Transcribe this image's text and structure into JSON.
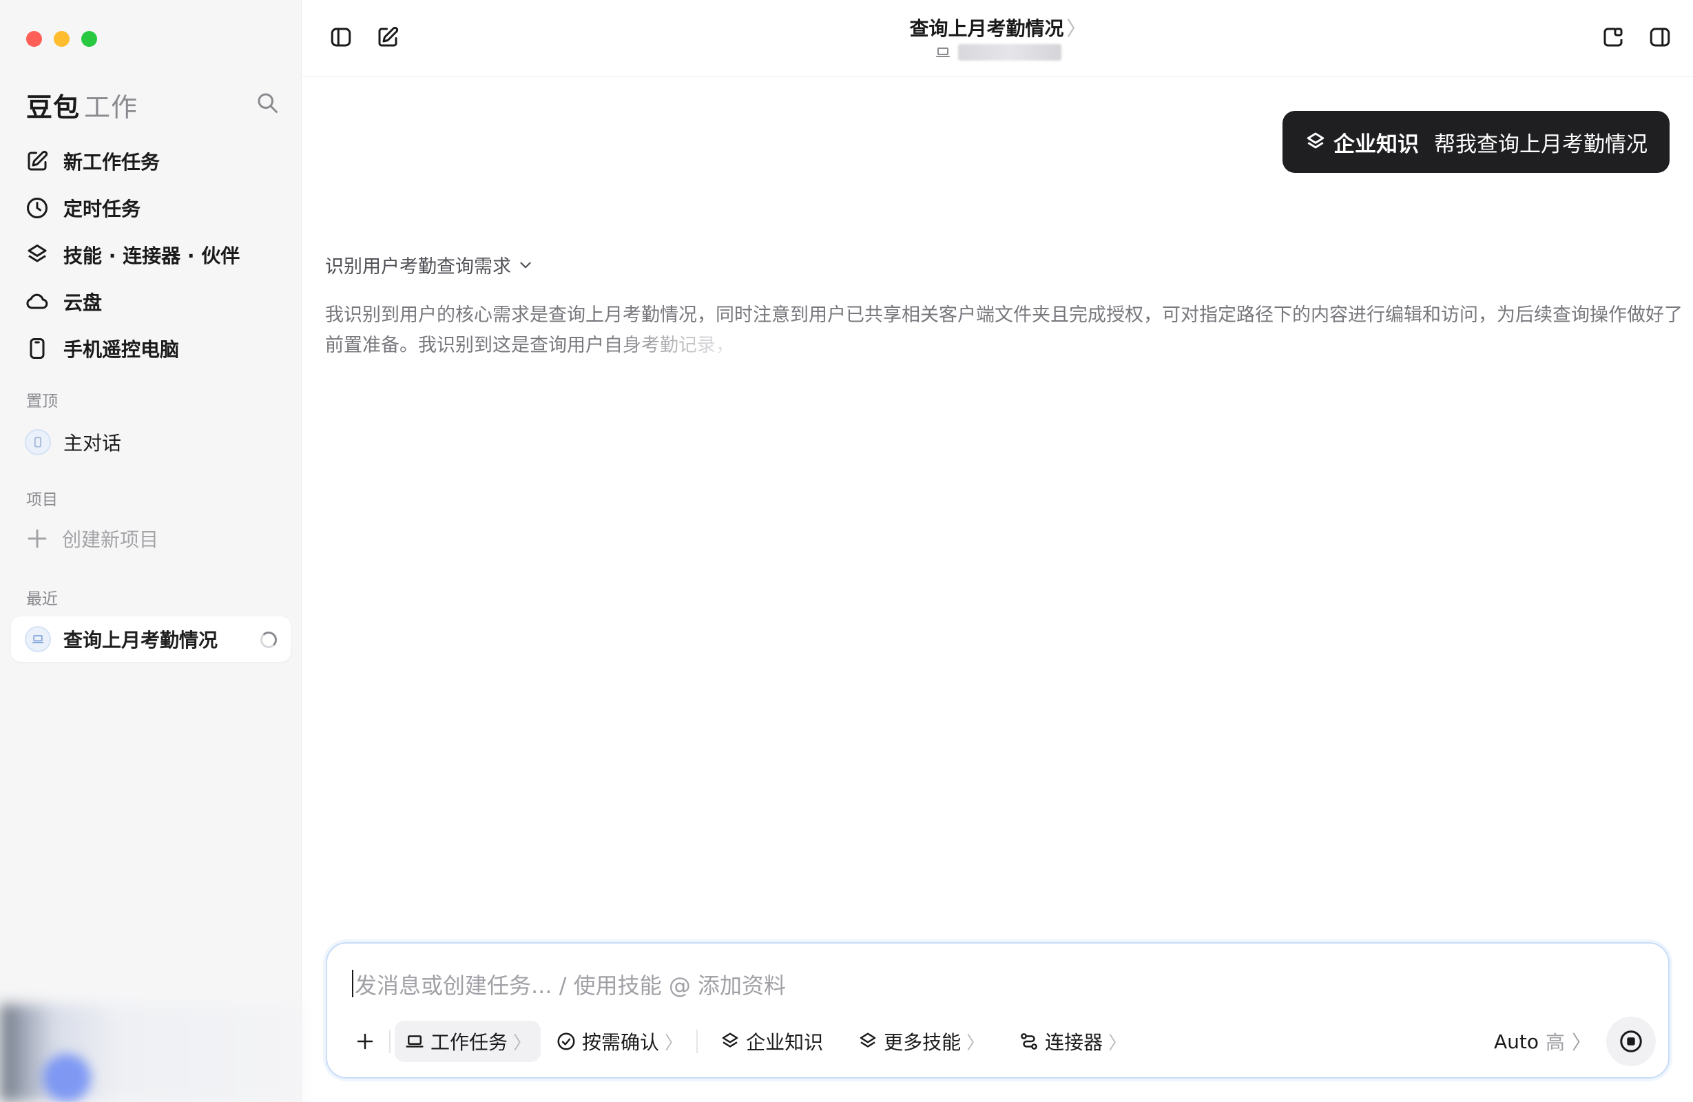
{
  "window": {
    "traffic_colors": [
      "#ff5f57",
      "#febc2e",
      "#28c840"
    ]
  },
  "sidebar": {
    "brand_name": "豆包",
    "brand_sub": "工作",
    "nav": [
      {
        "label": "新工作任务",
        "icon": "edit-icon"
      },
      {
        "label": "定时任务",
        "icon": "clock-icon"
      },
      {
        "label": "技能 · 连接器 · 伙伴",
        "icon": "layers-icon"
      },
      {
        "label": "云盘",
        "icon": "cloud-icon"
      },
      {
        "label": "手机遥控电脑",
        "icon": "phone-icon"
      }
    ],
    "pinned_label": "置顶",
    "pinned_item": "主对话",
    "projects_label": "项目",
    "create_project": "创建新项目",
    "recent_label": "最近",
    "recent_item": "查询上月考勤情况"
  },
  "header": {
    "title": "查询上月考勤情况",
    "title_chevron": "〉"
  },
  "conversation": {
    "user_message_tag": "企业知识",
    "user_message_text": "帮我查询上月考勤情况",
    "thinking_title": "识别用户考勤查询需求",
    "thinking_text": "我识别到用户的核心需求是查询上月考勤情况，同时注意到用户已共享相关客户端文件夹且完成授权，可对指定路径下的内容进行编辑和访问，为后续查询操作做好了前置准备。我识别到这是查询用户",
    "thinking_fade": "自身考勤记录，"
  },
  "composer": {
    "placeholder": "发消息或创建任务... / 使用技能 @ 添加资料",
    "tools": [
      {
        "label": "工作任务",
        "chevron": "〉"
      },
      {
        "label": "按需确认",
        "chevron": "〉"
      },
      {
        "label": "企业知识",
        "chevron": ""
      },
      {
        "label": "更多技能",
        "chevron": "〉"
      },
      {
        "label": "连接器",
        "chevron": "〉"
      }
    ],
    "mode": "Auto",
    "level": "高",
    "level_chevron": "〉"
  },
  "colors": {
    "accent_border": "#c9dcf8",
    "bubble_bg": "#1f1f22",
    "sidebar_bg": "#f6f6f7"
  }
}
